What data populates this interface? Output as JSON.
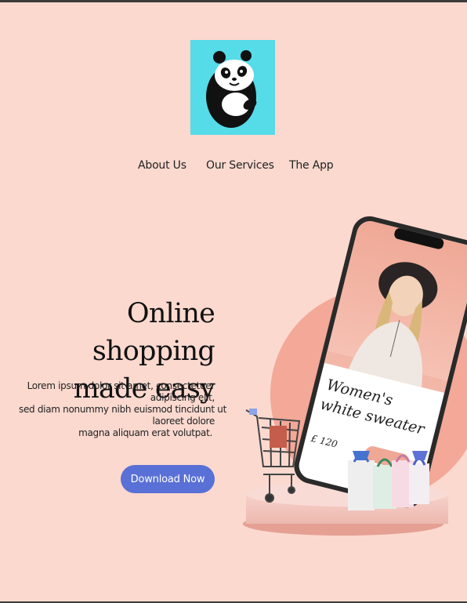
{
  "nav": {
    "items": [
      {
        "label": "About Us"
      },
      {
        "label": "Our Services"
      },
      {
        "label": "The App"
      }
    ]
  },
  "hero": {
    "headline_line1": "Online shopping",
    "headline_line2": "made easy",
    "body_lines": [
      "Lorem ipsum dolor sit amet, consectetuer",
      "adipiscing elit,",
      "sed diam nonummy nibh euismod tincidunt ut",
      "laoreet dolore",
      "magna aliquam erat volutpat."
    ],
    "cta_label": "Download Now"
  },
  "phone": {
    "product_title_line1": "Women's",
    "product_title_line2": "white sweater",
    "price": "£ 120"
  },
  "colors": {
    "background": "#fbd9cf",
    "logo_bg": "#56dbe8",
    "cta": "#5970d6",
    "accent_circle": "#f3a898"
  },
  "icons": {
    "logo": "panda-logo-icon",
    "cart": "shopping-cart-icon",
    "bags": "shopping-bags-icon"
  }
}
